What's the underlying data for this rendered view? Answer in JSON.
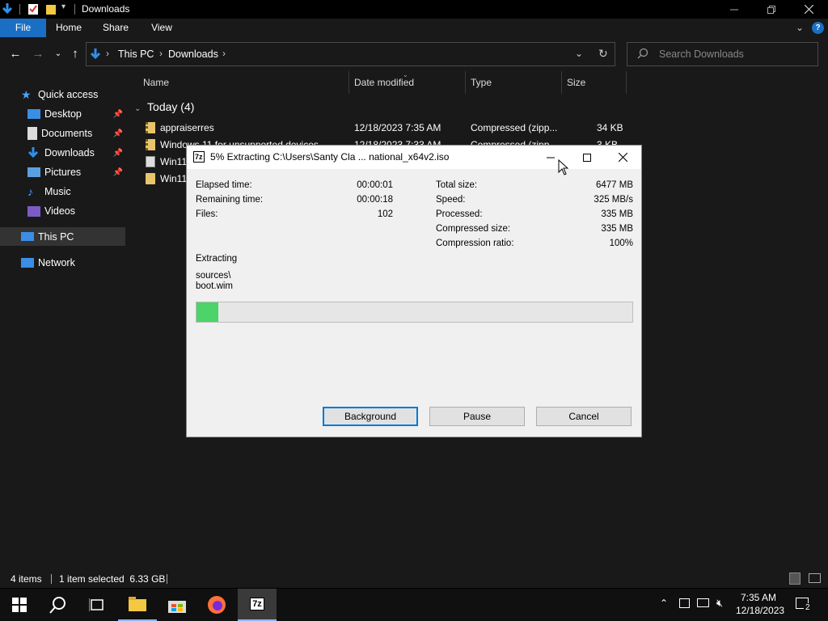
{
  "window": {
    "title": "Downloads"
  },
  "ribbon": {
    "tabs": [
      "File",
      "Home",
      "Share",
      "View"
    ]
  },
  "address": {
    "crumbs": [
      "This PC",
      "Downloads"
    ],
    "search_placeholder": "Search Downloads"
  },
  "nav": {
    "quick_access": "Quick access",
    "items": [
      {
        "label": "Desktop",
        "pinned": true,
        "icon": "desktop-icon"
      },
      {
        "label": "Documents",
        "pinned": true,
        "icon": "documents-icon"
      },
      {
        "label": "Downloads",
        "pinned": true,
        "icon": "downloads-icon"
      },
      {
        "label": "Pictures",
        "pinned": true,
        "icon": "pictures-icon"
      },
      {
        "label": "Music",
        "pinned": false,
        "icon": "music-icon"
      },
      {
        "label": "Videos",
        "pinned": false,
        "icon": "videos-icon"
      }
    ],
    "this_pc": "This PC",
    "network": "Network"
  },
  "content": {
    "columns": [
      "Name",
      "Date modified",
      "Type",
      "Size"
    ],
    "group": "Today (4)",
    "rows": [
      {
        "name": "appraiserres",
        "date": "12/18/2023 7:35 AM",
        "type": "Compressed (zipp...",
        "size": "34 KB",
        "icon": "zip-folder-icon"
      },
      {
        "name": "Windows 11 for unsupported devices",
        "date": "12/18/2023 7:33 AM",
        "type": "Compressed (zipp...",
        "size": "3 KB",
        "icon": "zip-folder-icon"
      },
      {
        "name": "Win11",
        "date": "",
        "type": "",
        "size": "",
        "icon": "iso-file-icon"
      },
      {
        "name": "Win11",
        "date": "",
        "type": "",
        "size": "",
        "icon": "folder-icon"
      }
    ]
  },
  "status": {
    "items_count": "4 items",
    "selected": "1 item selected  6.33 GB"
  },
  "dialog": {
    "title": "5% Extracting C:\\Users\\Santy Cla ... national_x64v2.iso",
    "left": [
      {
        "label": "Elapsed time:",
        "value": "00:00:01"
      },
      {
        "label": "Remaining time:",
        "value": "00:00:18"
      },
      {
        "label": "Files:",
        "value": "102"
      }
    ],
    "right": [
      {
        "label": "Total size:",
        "value": "6477 MB"
      },
      {
        "label": "Speed:",
        "value": "325 MB/s"
      },
      {
        "label": "Processed:",
        "value": "335 MB"
      },
      {
        "label": "Compressed size:",
        "value": "335 MB"
      },
      {
        "label": "Compression ratio:",
        "value": "100%"
      }
    ],
    "action": "Extracting",
    "path_line1": "sources\\",
    "path_line2": "boot.wim",
    "progress_percent": 5,
    "buttons": {
      "background": "Background",
      "pause": "Pause",
      "cancel": "Cancel"
    }
  },
  "taskbar": {
    "clock_time": "7:35 AM",
    "clock_date": "12/18/2023",
    "notification_count": "2"
  },
  "colors": {
    "accent": "#1a6fc4",
    "progress": "#4cd36a"
  }
}
